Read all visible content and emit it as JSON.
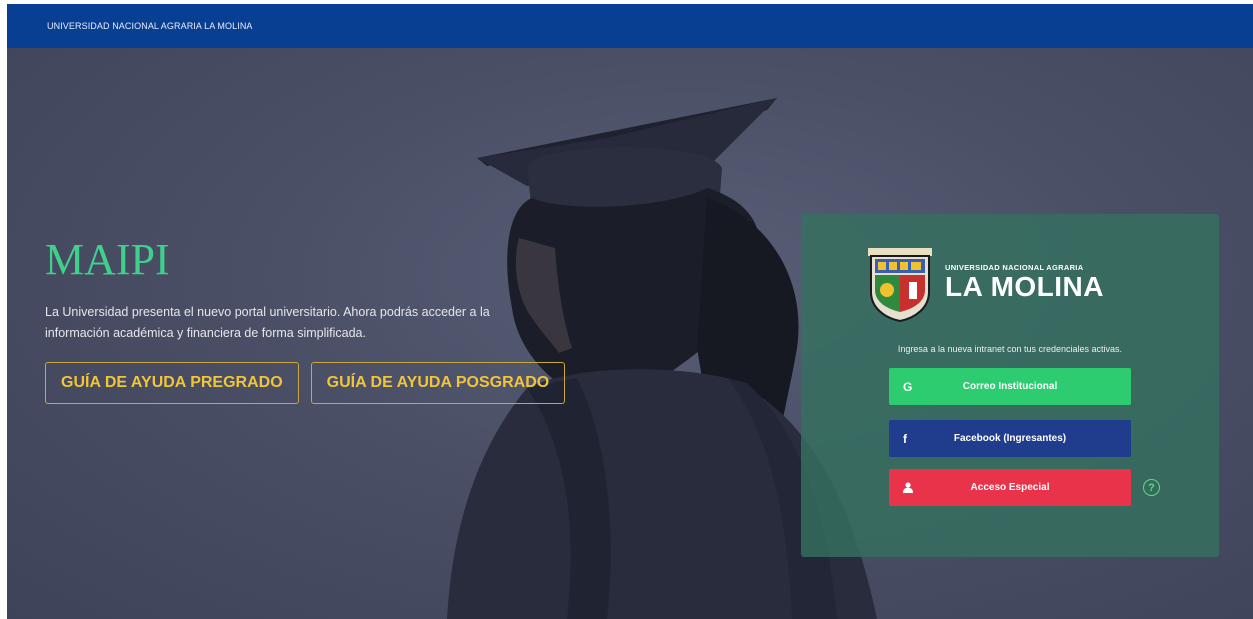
{
  "header": {
    "university_name": "UNIVERSIDAD NACIONAL AGRARIA LA MOLINA"
  },
  "hero": {
    "title": "MAIPI",
    "intro_line1": "La Universidad presenta el nuevo portal universitario. Ahora podrás acceder a la",
    "intro_line2": "información académica y financiera de forma simplificada.",
    "guide_pregrado": "GUÍA DE AYUDA PREGRADO",
    "guide_posgrado": "GUÍA DE AYUDA POSGRADO"
  },
  "login_panel": {
    "logo_small": "UNIVERSIDAD NACIONAL AGRARIA",
    "logo_big": "LA MOLINA",
    "instruction": "Ingresa a la nueva intranet con tus credenciales activas.",
    "buttons": [
      {
        "label": "Correo Institucional",
        "icon": "google-icon",
        "icon_glyph": "G",
        "color": "#2ecc71"
      },
      {
        "label": "Facebook (Ingresantes)",
        "icon": "facebook-icon",
        "icon_glyph": "f",
        "color": "#1f3d8c"
      },
      {
        "label": "Acceso Especial",
        "icon": "user-icon",
        "icon_glyph": "",
        "color": "#e8334a"
      }
    ],
    "help_glyph": "?"
  },
  "colors": {
    "topbar": "#083f92",
    "title": "#3fd08c",
    "guide_border": "#c9a73a",
    "panel": "#34705f"
  }
}
